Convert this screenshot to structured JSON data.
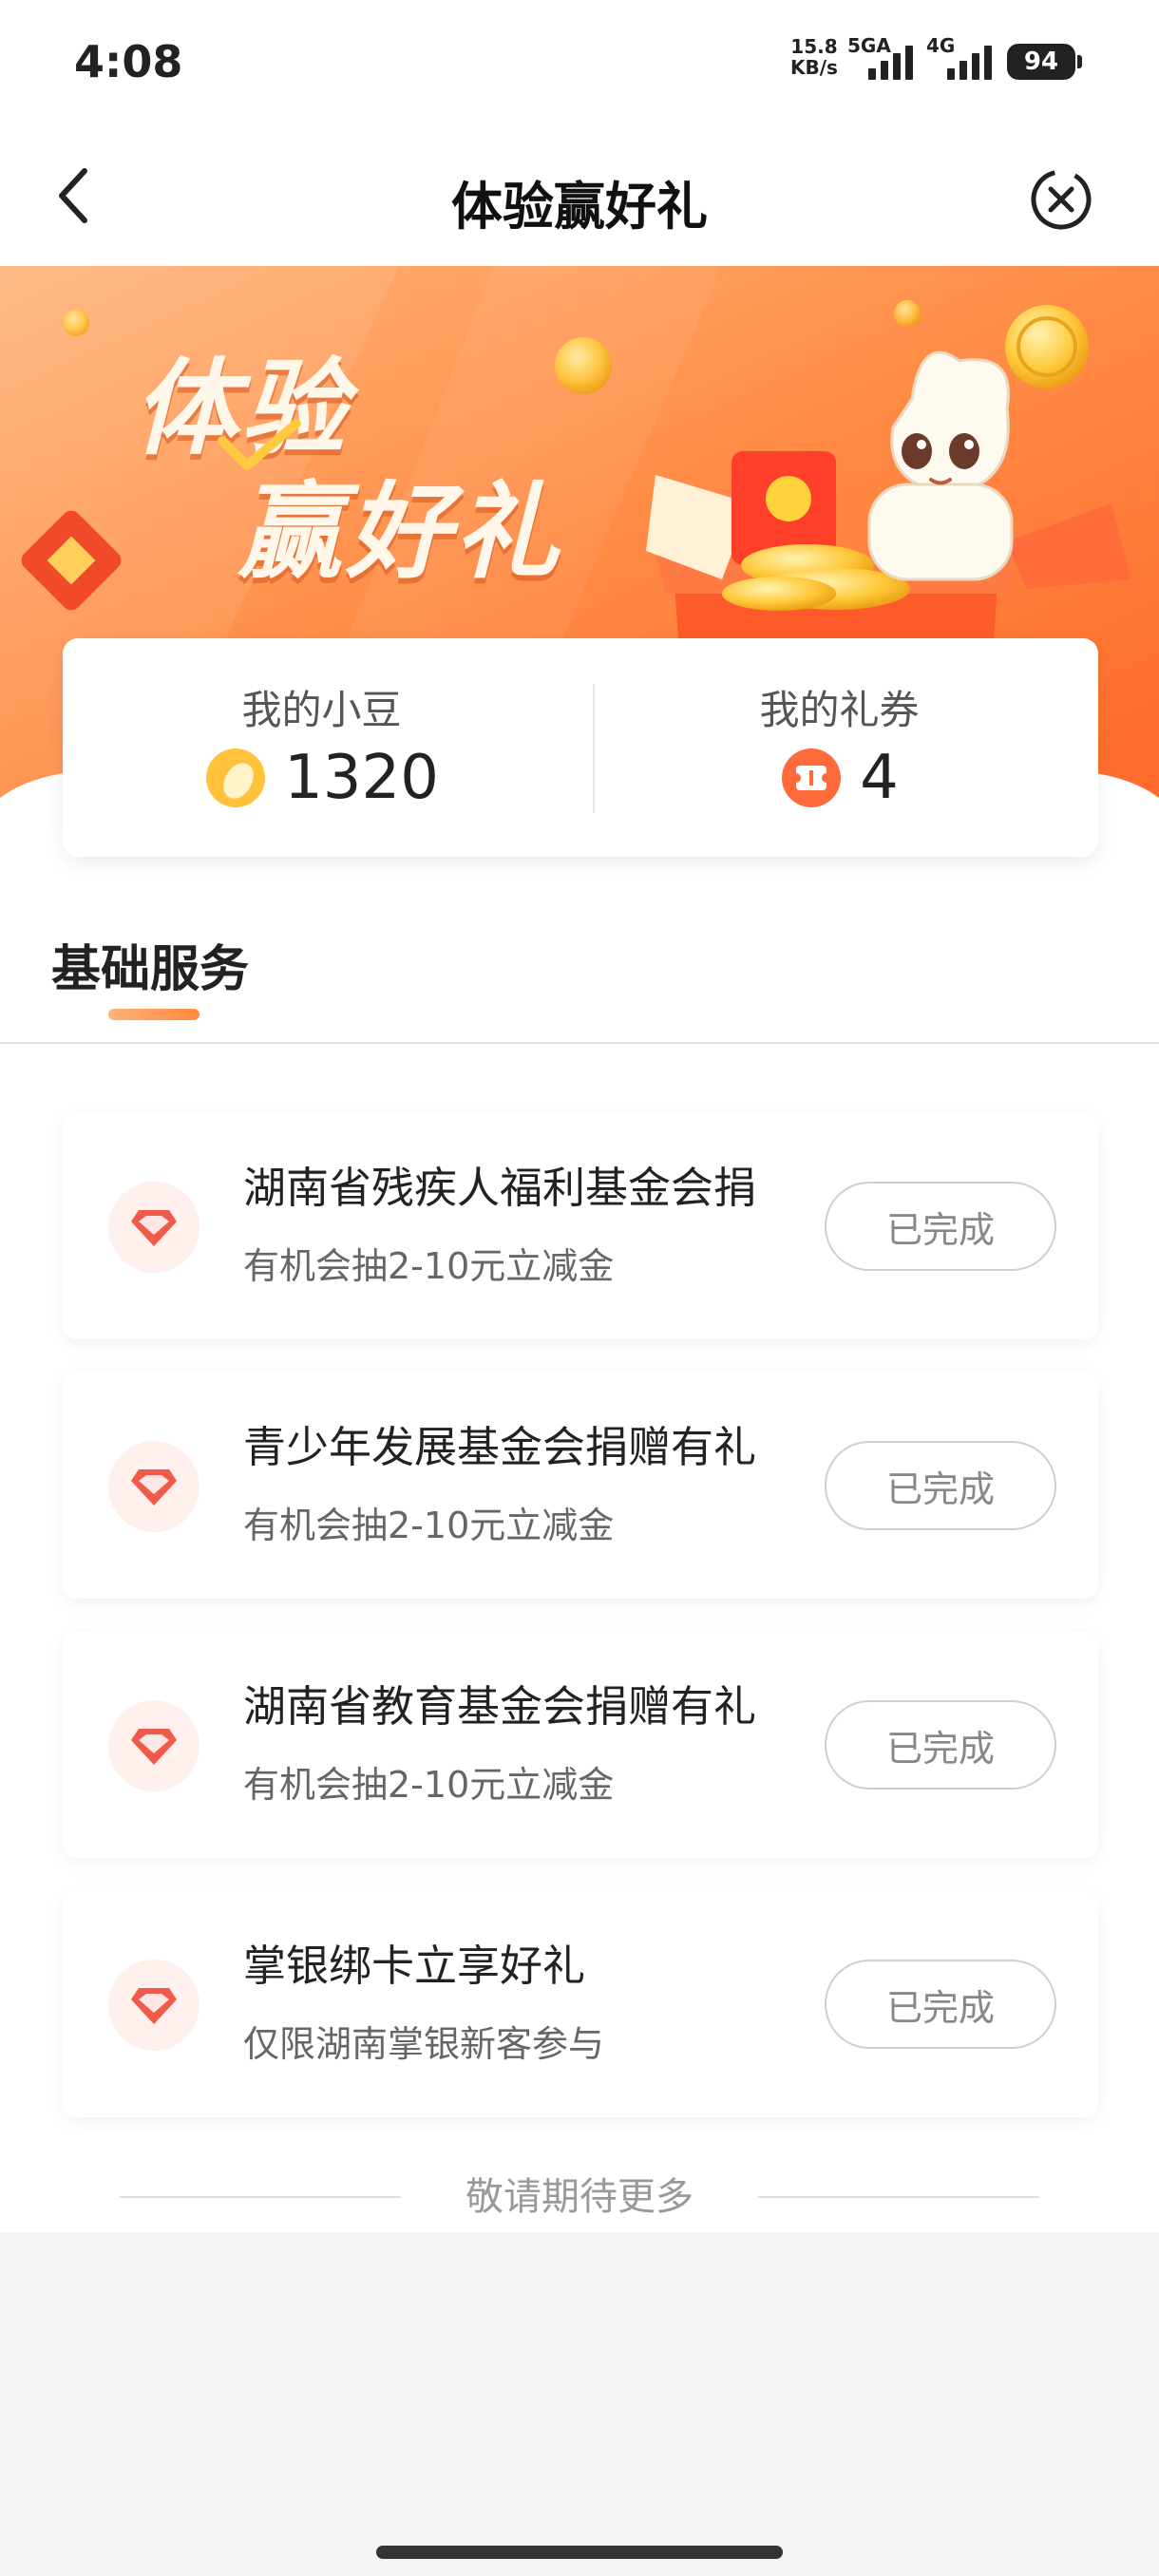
{
  "status_bar": {
    "time": "4:08",
    "net_speed_value": "15.8",
    "net_speed_unit": "KB/s",
    "signal1_label": "5GA",
    "signal2_label": "4G",
    "battery": "94"
  },
  "nav": {
    "title": "体验赢好礼",
    "back_icon": "chevron-left-icon",
    "close_icon": "close-circle-icon"
  },
  "banner": {
    "line1": "体验",
    "line2": "赢好礼",
    "accent_color": "#ff7a32"
  },
  "summary": {
    "beans_label": "我的小豆",
    "beans_value": "1320",
    "coupons_label": "我的礼券",
    "coupons_value": "4"
  },
  "section": {
    "title": "基础服务"
  },
  "tasks": [
    {
      "title": "湖南省残疾人福利基金会捐",
      "subtitle": "有机会抽2-10元立减金",
      "button": "已完成"
    },
    {
      "title": "青少年发展基金会捐赠有礼",
      "subtitle": "有机会抽2-10元立减金",
      "button": "已完成"
    },
    {
      "title": "湖南省教育基金会捐赠有礼",
      "subtitle": "有机会抽2-10元立减金",
      "button": "已完成"
    },
    {
      "title": "掌银绑卡立享好礼",
      "subtitle": "仅限湖南掌银新客参与",
      "button": "已完成"
    }
  ],
  "footer": {
    "text": "敬请期待更多"
  }
}
